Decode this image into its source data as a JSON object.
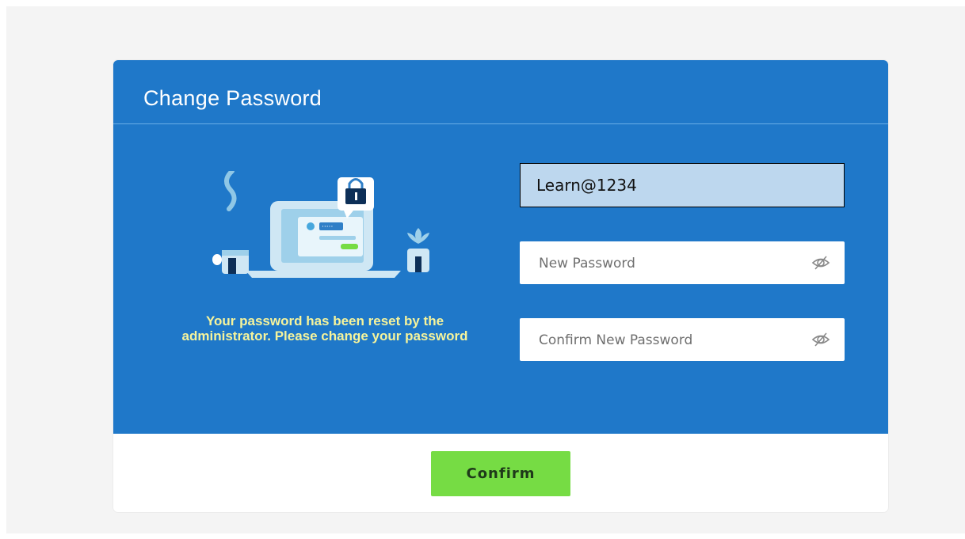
{
  "dialog": {
    "title": "Change Password",
    "message": "Your password has been reset by the administrator. Please change your password"
  },
  "form": {
    "old_password_value": "Learn@1234",
    "new_password_placeholder": "New Password",
    "confirm_password_placeholder": "Confirm New Password",
    "confirm_button_label": "Confirm"
  },
  "icons": {
    "illustration": "laptop-with-lock-illustration",
    "toggle_visibility": "eye-slash-icon"
  },
  "colors": {
    "panel_blue": "#1f78c9",
    "confirm_green": "#76dc44",
    "message_yellow": "#f6f49c",
    "highlight_field": "#bdd7ee"
  }
}
